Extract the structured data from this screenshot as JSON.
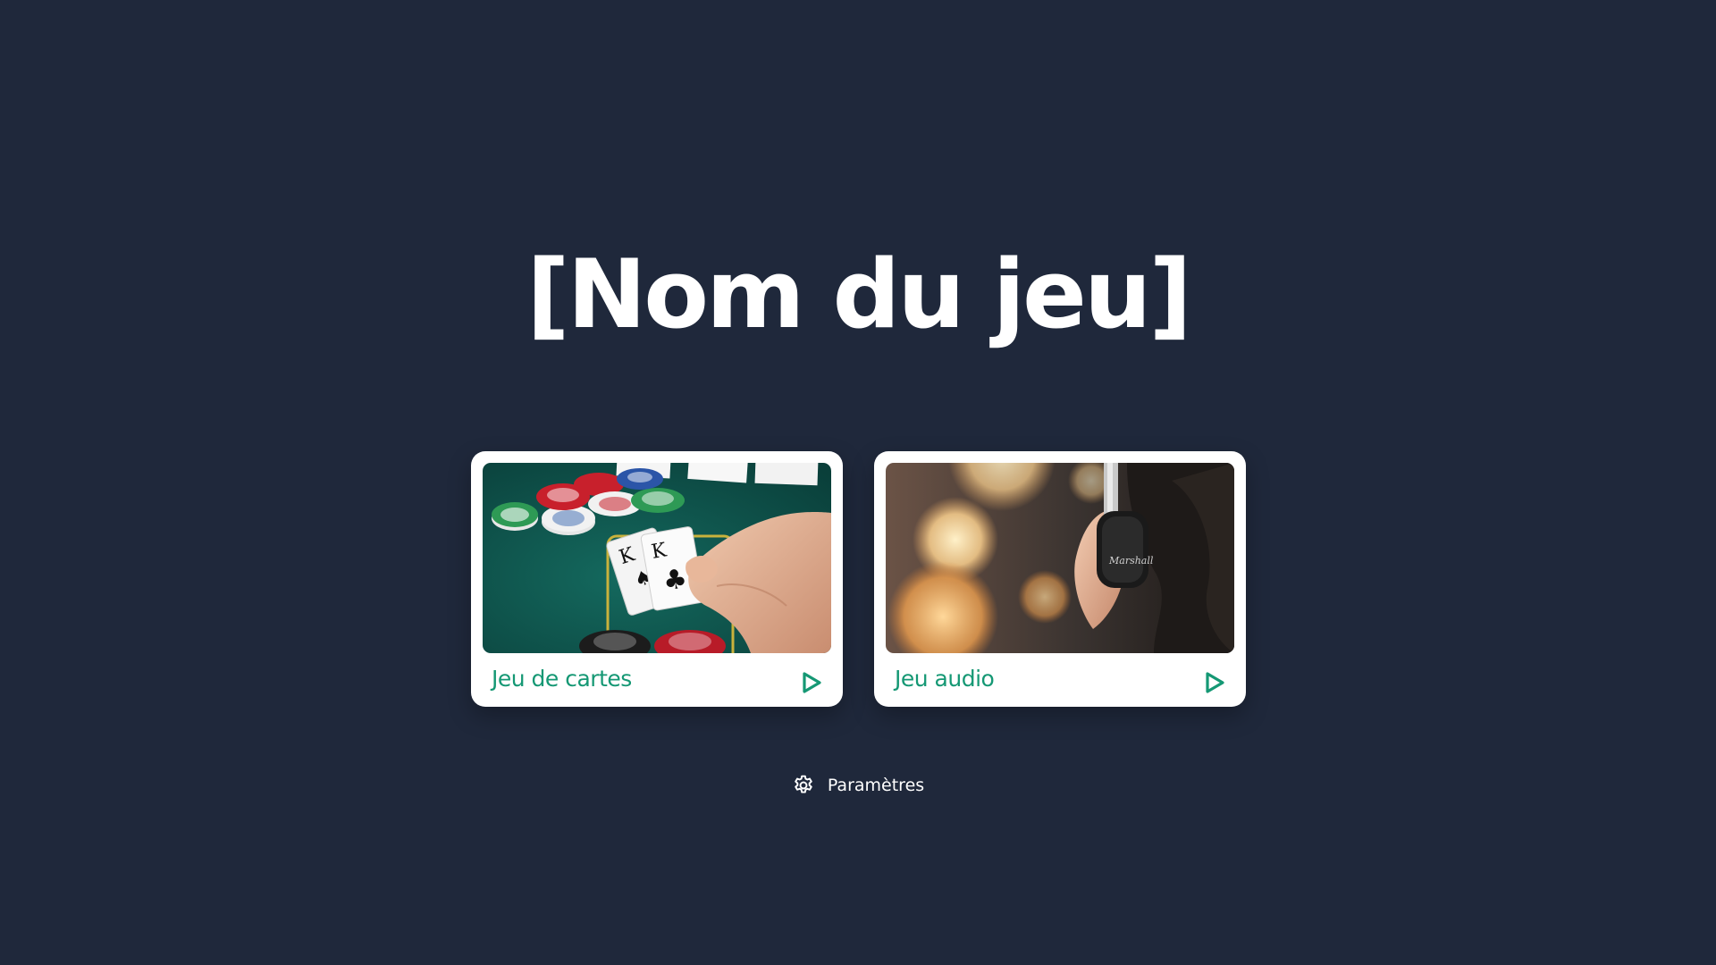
{
  "app": {
    "title": "[Nom du jeu]"
  },
  "games": [
    {
      "label": "Jeu de cartes",
      "icon": "play-icon",
      "image": "poker-table-photo"
    },
    {
      "label": "Jeu audio",
      "icon": "play-icon",
      "image": "headphones-photo"
    }
  ],
  "settings": {
    "label": "Paramètres",
    "icon": "gear-icon"
  },
  "colors": {
    "background": "#1f283b",
    "card": "#ffffff",
    "accent": "#159874",
    "text_light": "#ffffff"
  }
}
